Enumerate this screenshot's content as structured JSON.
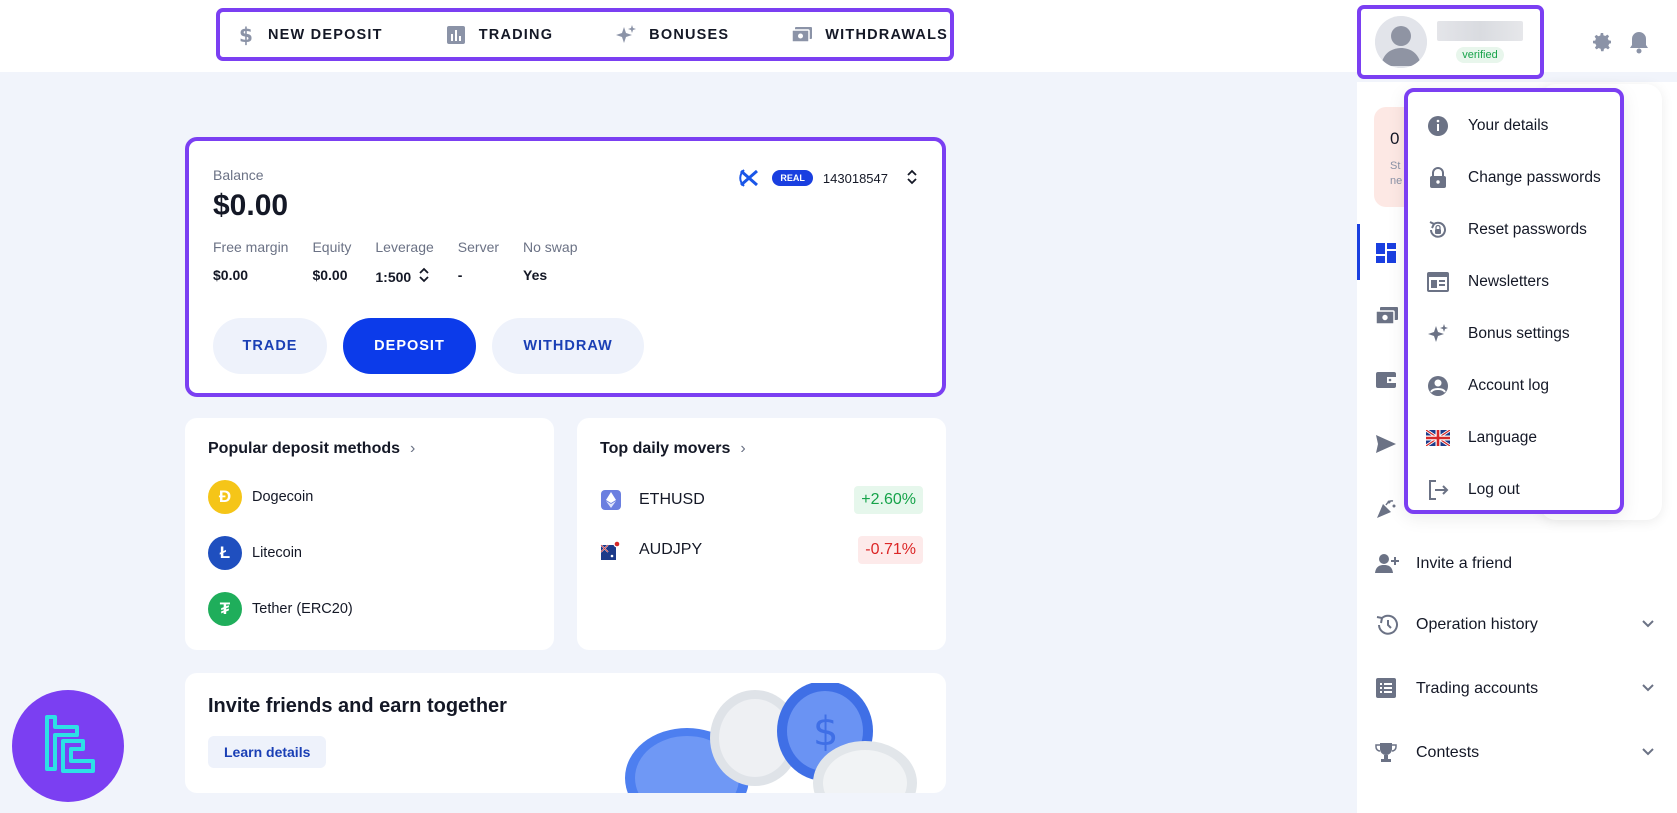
{
  "top_nav": {
    "items": [
      {
        "label": "NEW DEPOSIT",
        "icon": "dollar-icon"
      },
      {
        "label": "TRADING",
        "icon": "bar-chart-icon"
      },
      {
        "label": "BONUSES",
        "icon": "sparkle-icon"
      },
      {
        "label": "WITHDRAWALS",
        "icon": "cash-icon"
      }
    ]
  },
  "user": {
    "status": "verified"
  },
  "balance_card": {
    "balance_label": "Balance",
    "balance_value": "$0.00",
    "account_type": "REAL",
    "account_number": "143018547",
    "metrics": [
      {
        "label": "Free margin",
        "value": "$0.00"
      },
      {
        "label": "Equity",
        "value": "$0.00"
      },
      {
        "label": "Leverage",
        "value": "1:500"
      },
      {
        "label": "Server",
        "value": "-"
      },
      {
        "label": "No swap",
        "value": "Yes"
      }
    ],
    "actions": {
      "trade": "TRADE",
      "deposit": "DEPOSIT",
      "withdraw": "WITHDRAW"
    }
  },
  "deposit_methods": {
    "title": "Popular deposit methods",
    "items": [
      {
        "label": "Dogecoin",
        "color": "#f5c518",
        "glyph": "Ɖ"
      },
      {
        "label": "Litecoin",
        "color": "#1f4fbf",
        "glyph": "Ł"
      },
      {
        "label": "Tether (ERC20)",
        "color": "#1fae5b",
        "glyph": "₮"
      }
    ]
  },
  "top_movers": {
    "title": "Top daily movers",
    "items": [
      {
        "symbol": "ETHUSD",
        "change": "+2.60%",
        "direction": "up"
      },
      {
        "symbol": "AUDJPY",
        "change": "-0.71%",
        "direction": "down"
      }
    ]
  },
  "invite_card": {
    "title": "Invite friends and earn together",
    "button": "Learn details"
  },
  "sidebar": {
    "promo_peek_text": "0",
    "promo_peek_small": "St\nne",
    "items": [
      {
        "label": "Invite a friend",
        "icon": "add-person-icon",
        "expandable": false
      },
      {
        "label": "Operation history",
        "icon": "history-icon",
        "expandable": true
      },
      {
        "label": "Trading accounts",
        "icon": "list-icon",
        "expandable": true
      },
      {
        "label": "Contests",
        "icon": "trophy-icon",
        "expandable": true
      }
    ]
  },
  "user_menu": {
    "items": [
      {
        "label": "Your details",
        "icon": "info-icon"
      },
      {
        "label": "Change passwords",
        "icon": "lock-icon"
      },
      {
        "label": "Reset passwords",
        "icon": "reset-lock-icon"
      },
      {
        "label": "Newsletters",
        "icon": "newsletter-icon"
      },
      {
        "label": "Bonus settings",
        "icon": "sparkle-icon"
      },
      {
        "label": "Account log",
        "icon": "account-circle-icon"
      },
      {
        "label": "Language",
        "icon": "uk-flag-icon"
      },
      {
        "label": "Log out",
        "icon": "logout-icon"
      }
    ]
  },
  "colors": {
    "accent_outline": "#7b3ff2",
    "primary": "#0c3bea",
    "positive": "#16a34a",
    "negative": "#dc2626"
  }
}
